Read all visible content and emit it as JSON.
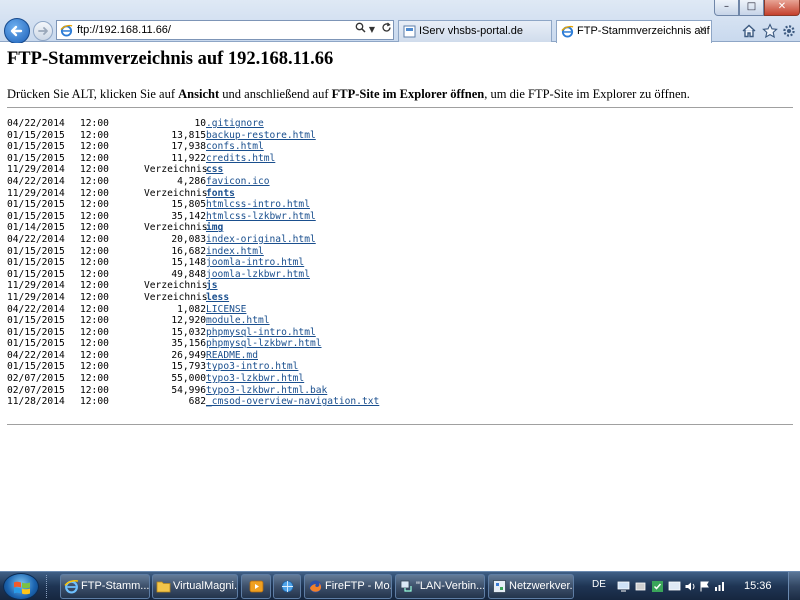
{
  "browser": {
    "address": "ftp://192.168.11.66/",
    "tabs": [
      {
        "label": "IServ vhsbs-portal.de"
      },
      {
        "label": "FTP-Stammverzeichnis auf ..."
      }
    ],
    "tab_close": "✕",
    "window_buttons": {
      "minimize": "–",
      "maximize": "□",
      "close": "✕"
    }
  },
  "page": {
    "title": "FTP-Stammverzeichnis auf 192.168.11.66",
    "instruction": {
      "part1": "Drücken Sie ALT, klicken Sie auf ",
      "bold1": "Ansicht",
      "part2": " und anschließend auf ",
      "bold2": "FTP-Site im Explorer öffnen",
      "part3": ", um die FTP-Site im Explorer zu öffnen."
    },
    "dir_label": "Verzeichnis",
    "entries": [
      {
        "date": "04/22/2014",
        "time": "12:00",
        "size": "10",
        "name": ".gitignore",
        "dir": false
      },
      {
        "date": "01/15/2015",
        "time": "12:00",
        "size": "13,815",
        "name": "backup-restore.html",
        "dir": false
      },
      {
        "date": "01/15/2015",
        "time": "12:00",
        "size": "17,938",
        "name": "confs.html",
        "dir": false
      },
      {
        "date": "01/15/2015",
        "time": "12:00",
        "size": "11,922",
        "name": "credits.html",
        "dir": false
      },
      {
        "date": "11/29/2014",
        "time": "12:00",
        "size": "",
        "name": "css",
        "dir": true
      },
      {
        "date": "04/22/2014",
        "time": "12:00",
        "size": "4,286",
        "name": "favicon.ico",
        "dir": false
      },
      {
        "date": "11/29/2014",
        "time": "12:00",
        "size": "",
        "name": "fonts",
        "dir": true
      },
      {
        "date": "01/15/2015",
        "time": "12:00",
        "size": "15,805",
        "name": "htmlcss-intro.html",
        "dir": false
      },
      {
        "date": "01/15/2015",
        "time": "12:00",
        "size": "35,142",
        "name": "htmlcss-lzkbwr.html",
        "dir": false
      },
      {
        "date": "01/14/2015",
        "time": "12:00",
        "size": "",
        "name": "img",
        "dir": true
      },
      {
        "date": "04/22/2014",
        "time": "12:00",
        "size": "20,083",
        "name": "index-original.html",
        "dir": false
      },
      {
        "date": "01/15/2015",
        "time": "12:00",
        "size": "16,682",
        "name": "index.html",
        "dir": false
      },
      {
        "date": "01/15/2015",
        "time": "12:00",
        "size": "15,148",
        "name": "joomla-intro.html",
        "dir": false
      },
      {
        "date": "01/15/2015",
        "time": "12:00",
        "size": "49,848",
        "name": "joomla-lzkbwr.html",
        "dir": false
      },
      {
        "date": "11/29/2014",
        "time": "12:00",
        "size": "",
        "name": "js",
        "dir": true
      },
      {
        "date": "11/29/2014",
        "time": "12:00",
        "size": "",
        "name": "less",
        "dir": true
      },
      {
        "date": "04/22/2014",
        "time": "12:00",
        "size": "1,082",
        "name": "LICENSE",
        "dir": false
      },
      {
        "date": "01/15/2015",
        "time": "12:00",
        "size": "12,920",
        "name": "module.html",
        "dir": false
      },
      {
        "date": "01/15/2015",
        "time": "12:00",
        "size": "15,032",
        "name": "phpmysql-intro.html",
        "dir": false
      },
      {
        "date": "01/15/2015",
        "time": "12:00",
        "size": "35,156",
        "name": "phpmysql-lzkbwr.html",
        "dir": false
      },
      {
        "date": "04/22/2014",
        "time": "12:00",
        "size": "26,949",
        "name": "README.md",
        "dir": false
      },
      {
        "date": "01/15/2015",
        "time": "12:00",
        "size": "15,793",
        "name": "typo3-intro.html",
        "dir": false
      },
      {
        "date": "02/07/2015",
        "time": "12:00",
        "size": "55,000",
        "name": "typo3-lzkbwr.html",
        "dir": false
      },
      {
        "date": "02/07/2015",
        "time": "12:00",
        "size": "54,996",
        "name": "typo3-lzkbwr.html.bak",
        "dir": false
      },
      {
        "date": "11/28/2014",
        "time": "12:00",
        "size": "682",
        "name": "_cmsod-overview-navigation.txt",
        "dir": false
      }
    ]
  },
  "taskbar": {
    "items": [
      {
        "label": "FTP-Stamm...",
        "icon": "ie-icon"
      },
      {
        "label": "VirtualMagni...",
        "icon": "folder-icon"
      },
      {
        "label": "",
        "icon": "media-player-icon"
      },
      {
        "label": "",
        "icon": "network-icon"
      },
      {
        "label": "FireFTP - Mo...",
        "icon": "firefox-icon"
      },
      {
        "label": "\"LAN-Verbin...",
        "icon": "network-connection-icon"
      },
      {
        "label": "Netzwerkver...",
        "icon": "network-settings-icon"
      }
    ],
    "language": "DE",
    "clock": "15:36"
  },
  "colors": {
    "link": "#1a4f8e",
    "taskbar": "#1f3554",
    "chrome": "#c9d9ee"
  }
}
